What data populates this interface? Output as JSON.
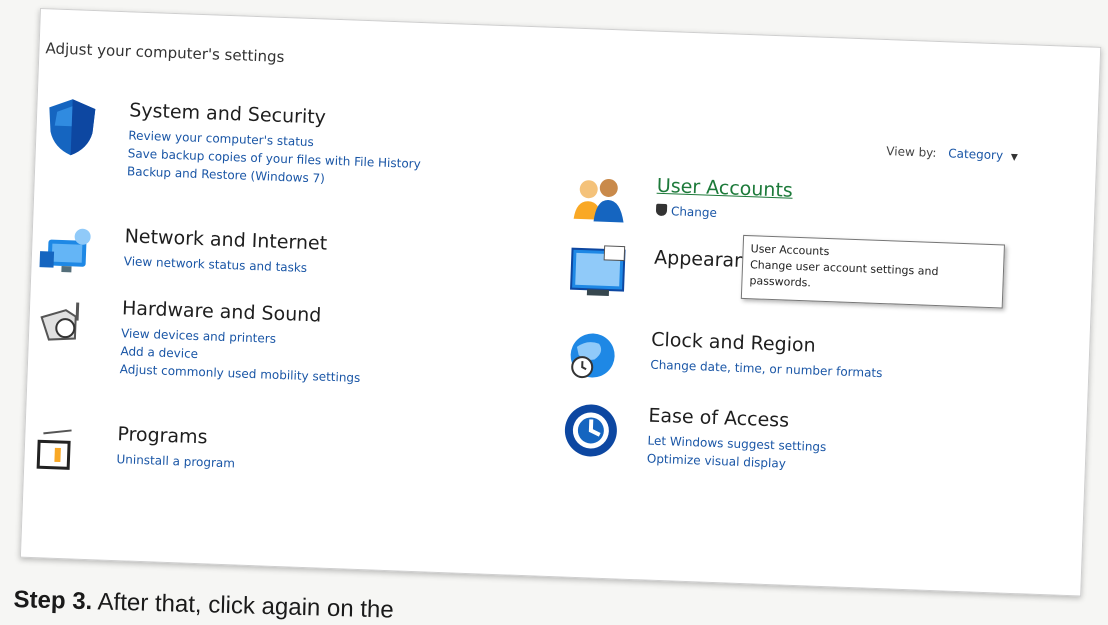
{
  "header": {
    "title": "Adjust your computer's settings"
  },
  "view_by": {
    "label": "View by:",
    "value": "Category"
  },
  "categories_left": [
    {
      "title": "System and Security",
      "links": [
        "Review your computer's status",
        "Save backup copies of your files with File History",
        "Backup and Restore (Windows 7)"
      ]
    },
    {
      "title": "Network and Internet",
      "links": [
        "View network status and tasks"
      ]
    },
    {
      "title": "Hardware and Sound",
      "links": [
        "View devices and printers",
        "Add a device",
        "Adjust commonly used mobility settings"
      ]
    },
    {
      "title": "Programs",
      "links": [
        "Uninstall a program"
      ]
    }
  ],
  "categories_right": [
    {
      "title": "User Accounts",
      "links": [
        "Change"
      ]
    },
    {
      "title": "Appearance"
    },
    {
      "title": "Clock and Region",
      "links": [
        "Change date, time, or number formats"
      ]
    },
    {
      "title": "Ease of Access",
      "links": [
        "Let Windows suggest settings",
        "Optimize visual display"
      ]
    }
  ],
  "tooltip": {
    "line1": "User Accounts",
    "line2": "Change user account settings and passwords."
  },
  "caption": {
    "step": "Step 3.",
    "text": "After that, click again on the"
  },
  "colors": {
    "link": "#1a56a6",
    "hover_link": "#1d7a3a",
    "icon_blue": "#1565c0"
  }
}
